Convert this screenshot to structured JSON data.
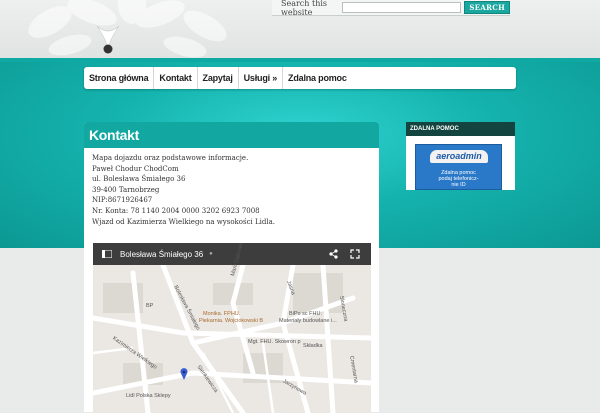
{
  "header": {
    "search": {
      "label": "Search this website",
      "button_label": "SEARCH",
      "value": ""
    }
  },
  "nav": {
    "items": [
      {
        "label": "Strona główna"
      },
      {
        "label": "Kontakt"
      },
      {
        "label": "Zapytaj"
      },
      {
        "label": "Usługi »"
      },
      {
        "label": "Zdalna pomoc"
      }
    ]
  },
  "content": {
    "title": "Kontakt",
    "lines": [
      "Mapa dojazdu oraz podstawowe informacje.",
      "Paweł Chodur ChodCom",
      "ul. Bolesława Śmiałego 36",
      "39-400 Tarnobrzeg",
      "NIP:8671926467",
      "Nr. Konta: 78 1140 2004 0000 3202 6923 7008",
      "Wjazd od Kazimierza Wielkiego na wysokości Lidla."
    ],
    "map": {
      "title": "Bolesława Śmiałego 36",
      "labels": {
        "bp": "BP",
        "monika": "Monika. FPHU.",
        "piekarnia": "Piekarnia. Wojciokowski B",
        "bipo": "BiPo sc FHU.",
        "materialy": "Materiały budowlane i...",
        "mgt": "Mgt. FHU. Skowron p",
        "lidl": "Lidl Polska Sklepy",
        "street_smialego": "Bolesława Śmiałego",
        "street_dabrowskiej": "Marii Dąbrowskiej",
        "street_kazimierza": "Kazimierza Wielkiego",
        "street_sienkiewicza": "Sienkiewicza",
        "street_jasna": "Jasna",
        "street_sloneczna": "Słoneczna",
        "street_skladka": "Składka",
        "street_jarzynowa": "Jarzynowa",
        "street_cmentarna": "Cmentarna"
      }
    }
  },
  "sidebar": {
    "title": "ZDALNA POMOC",
    "ad": {
      "logo": "aeroadmin",
      "line1": "Zdalna pomoc",
      "line2": "podaj telefonicz-",
      "line3": "nie ID"
    }
  },
  "colors": {
    "teal": "#15b3ae",
    "teal_dark": "#12a7a1",
    "sidebar_head": "#13443f",
    "search_button": "#1aa79f"
  }
}
